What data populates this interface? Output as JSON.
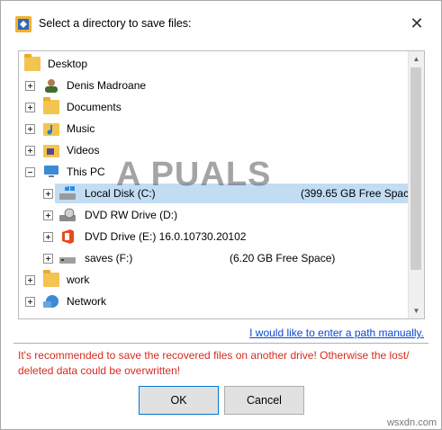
{
  "window": {
    "title": "Select a directory to save files:",
    "close_glyph": "✕"
  },
  "tree": {
    "items": [
      {
        "label": "Desktop"
      },
      {
        "label": "Denis Madroane"
      },
      {
        "label": "Documents"
      },
      {
        "label": "Music"
      },
      {
        "label": "Videos"
      },
      {
        "label": "This PC"
      },
      {
        "label": "Local Disk (C:)",
        "space": "(399.65 GB Free Spac"
      },
      {
        "label": "DVD RW Drive (D:)"
      },
      {
        "label": "DVD Drive (E:) 16.0.10730.20102"
      },
      {
        "label": "saves (F:)",
        "space": "(6.20 GB Free Space)"
      },
      {
        "label": "work"
      },
      {
        "label": "Network"
      }
    ]
  },
  "manual_link": "I would like to enter a path manually.",
  "warning": "It's recommended to save the recovered files on another drive! Otherwise the lost/ deleted data could be overwritten!",
  "buttons": {
    "ok": "OK",
    "cancel": "Cancel"
  },
  "watermark": {
    "brand": "A PUALS",
    "site": "wsxdn.com"
  },
  "colors": {
    "selection": "#c2dcf4",
    "link": "#0a46d6",
    "warning": "#d62b1f",
    "folder": "#f3c44f"
  }
}
